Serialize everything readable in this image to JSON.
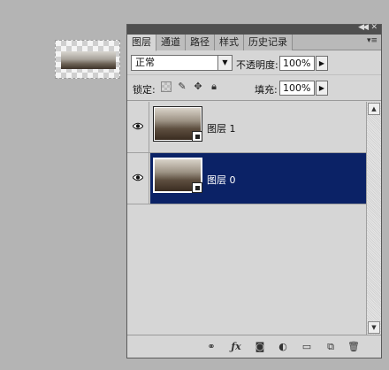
{
  "tabs": [
    "图层",
    "通道",
    "路径",
    "样式",
    "历史记录"
  ],
  "blend_mode": "正常",
  "opacity_label": "不透明度:",
  "opacity_value": "100%",
  "lock_label": "锁定:",
  "fill_label": "填充:",
  "fill_value": "100%",
  "layers": [
    {
      "name": "图层 1",
      "visible": true,
      "selected": false
    },
    {
      "name": "图层 0",
      "visible": true,
      "selected": true
    }
  ],
  "colors": {
    "selection": "#0b2266",
    "panel_bg": "#d6d6d6",
    "canvas_bg": "#b4b4b4"
  },
  "icons": {
    "titlebar": [
      "collapse-icon",
      "close-icon"
    ],
    "lock": [
      "lock-transparent-icon",
      "lock-brush-icon",
      "lock-move-icon",
      "lock-all-icon"
    ],
    "footer": [
      "link-layers-icon",
      "fx-icon",
      "add-mask-icon",
      "adjustment-layer-icon",
      "new-group-icon",
      "new-layer-icon",
      "delete-layer-icon"
    ]
  }
}
